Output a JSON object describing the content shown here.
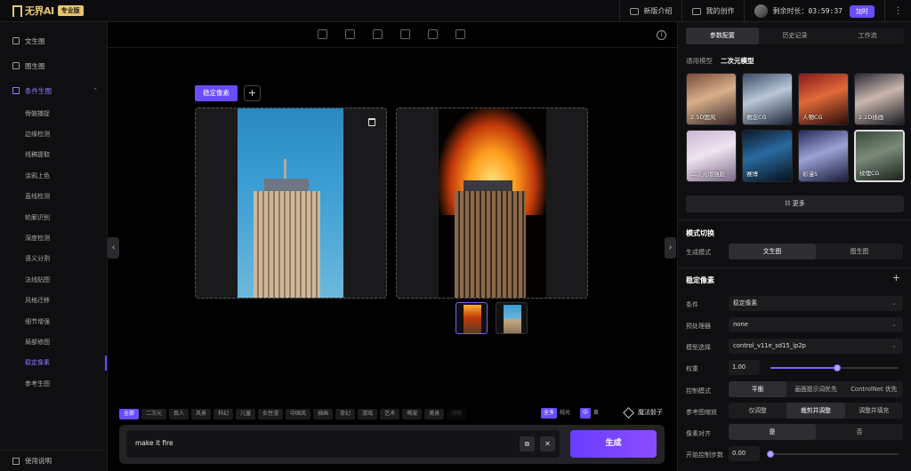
{
  "topbar": {
    "logo_text": "无界AI",
    "badge": "专业版",
    "whats_new": "新版介绍",
    "my_works": "我的创作",
    "remaining_label": "剩余时长：",
    "remaining_time": "03:59:37",
    "recharge": "加时",
    "more": "⋮"
  },
  "sidebar": {
    "items": [
      {
        "label": "文生图"
      },
      {
        "label": "图生图"
      },
      {
        "label": "条件生图"
      }
    ],
    "sub_items": [
      {
        "label": "骨骼捕捉"
      },
      {
        "label": "边缘检测"
      },
      {
        "label": "线稿提取"
      },
      {
        "label": "涂鸦上色"
      },
      {
        "label": "直线检测"
      },
      {
        "label": "轮廓识别"
      },
      {
        "label": "深度检测"
      },
      {
        "label": "语义分割"
      },
      {
        "label": "法线贴图"
      },
      {
        "label": "风格迁移"
      },
      {
        "label": "细节增强"
      },
      {
        "label": "局部修图"
      },
      {
        "label": "稳定像素"
      },
      {
        "label": "参考生图"
      }
    ],
    "help": "使用说明"
  },
  "canvas": {
    "condition_tab": "稳定像素",
    "add": "+",
    "collapse_left": "‹",
    "collapse_right": "›",
    "info": "i"
  },
  "tags": [
    "全部",
    "二次元",
    "真人",
    "风景",
    "科幻",
    "儿童",
    "女性漫",
    "中国风",
    "插画",
    "奇幻",
    "游戏",
    "艺术",
    "萌宠",
    "美食",
    "动物"
  ],
  "mode_tags": {
    "all": "全多",
    "pure": "纯光",
    "mid": "中",
    "yellow": "黄"
  },
  "magic_dice": "魔法骰子",
  "prompt": {
    "text": "make it fire",
    "copy": "⧉",
    "clear": "✕",
    "generate": "生成"
  },
  "right": {
    "tabs": [
      "参数配置",
      "历史记录",
      "工作流"
    ],
    "model_general": "通用模型",
    "model_anime": "二次元模型",
    "models": [
      {
        "label": "2.5D国风"
      },
      {
        "label": "概念CG"
      },
      {
        "label": "人物CG"
      },
      {
        "label": "2.2D插画"
      },
      {
        "label": "二次元增强版"
      },
      {
        "label": "赛博"
      },
      {
        "label": "彩漫5"
      },
      {
        "label": "纹理CG"
      }
    ],
    "more_models": "☷ 更多",
    "mode_switch_title": "模式切换",
    "gen_mode_label": "生成模式",
    "gen_modes": [
      "文生图",
      "图生图"
    ],
    "stable_title": "稳定像素",
    "condition_label": "条件",
    "condition_value": "稳定像素",
    "preprocessor_label": "预处理器",
    "preprocessor_value": "none",
    "model_select_label": "模型选择",
    "model_select_value": "control_v11e_sd15_ip2p",
    "weight_label": "权重",
    "weight_value": "1.00",
    "weight_fraction": 0.52,
    "control_mode_label": "控制模式",
    "control_modes": [
      "平衡",
      "画面提示词优先",
      "ControlNet 优先"
    ],
    "ref_scale_label": "参考图缩放",
    "ref_scales": [
      "仅调整",
      "裁剪并调整",
      "调整并填充"
    ],
    "pixel_align_label": "像素对齐",
    "pixel_align": [
      "是",
      "否"
    ],
    "start_steps_label": "开始控制步数",
    "start_steps_value": "0.00",
    "start_steps_fraction": 0.0
  },
  "colors": {
    "accent": "#6b4cff",
    "gold": "#e7c56b"
  }
}
